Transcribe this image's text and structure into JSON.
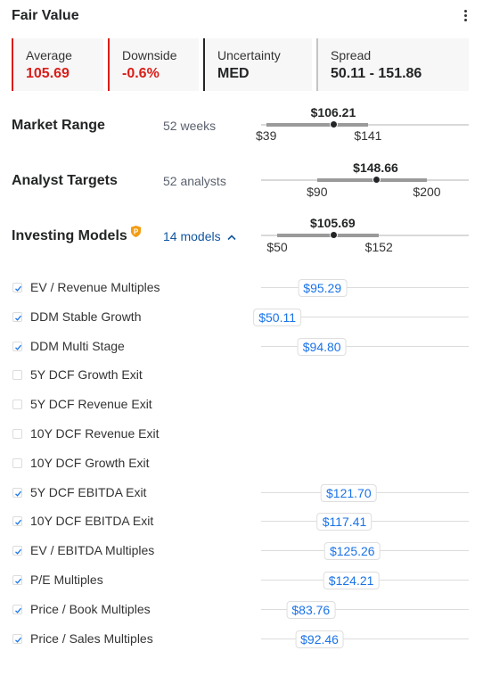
{
  "header": {
    "title": "Fair Value",
    "menu_icon": "more-vertical-icon"
  },
  "cards": [
    {
      "label": "Average",
      "value": "105.69",
      "accent": "#d91e18"
    },
    {
      "label": "Downside",
      "value": "-0.6%",
      "accent": "#d91e18"
    },
    {
      "label": "Uncertainty",
      "value": "MED",
      "accent": "#232526"
    },
    {
      "label": "Spread",
      "value": "50.11 - 151.86",
      "accent": "#c4c4c4"
    }
  ],
  "ranges": [
    {
      "name": "Market Range",
      "sub": "52 weeks",
      "current": "$106.21",
      "current_value": 106.21,
      "low_label": "$39",
      "low": 39,
      "high_label": "$141",
      "high": 141
    },
    {
      "name": "Analyst Targets",
      "sub": "52 analysts",
      "current": "$148.66",
      "current_value": 148.66,
      "low_label": "$90",
      "low": 90,
      "high_label": "$200",
      "high": 200
    },
    {
      "name": "Investing Models",
      "sub": "14 models",
      "sub_icon": "chevron-up-icon",
      "badge_icon": "pro-shield-icon",
      "current": "$105.69",
      "current_value": 105.69,
      "low_label": "$50",
      "low": 50,
      "high_label": "$152",
      "high": 152
    }
  ],
  "models": [
    {
      "label": "EV / Revenue Multiples",
      "checked": true,
      "value_label": "$95.29",
      "value": 95.29
    },
    {
      "label": "DDM Stable Growth",
      "checked": true,
      "value_label": "$50.11",
      "value": 50.11
    },
    {
      "label": "DDM Multi Stage",
      "checked": true,
      "value_label": "$94.80",
      "value": 94.8
    },
    {
      "label": "5Y DCF Growth Exit",
      "checked": false
    },
    {
      "label": "5Y DCF Revenue Exit",
      "checked": false
    },
    {
      "label": "10Y DCF Revenue Exit",
      "checked": false
    },
    {
      "label": "10Y DCF Growth Exit",
      "checked": false
    },
    {
      "label": "5Y DCF EBITDA Exit",
      "checked": true,
      "value_label": "$121.70",
      "value": 121.7
    },
    {
      "label": "10Y DCF EBITDA Exit",
      "checked": true,
      "value_label": "$117.41",
      "value": 117.41
    },
    {
      "label": "EV / EBITDA Multiples",
      "checked": true,
      "value_label": "$125.26",
      "value": 125.26
    },
    {
      "label": "P/E Multiples",
      "checked": true,
      "value_label": "$124.21",
      "value": 124.21
    },
    {
      "label": "Price / Book Multiples",
      "checked": true,
      "value_label": "$83.76",
      "value": 83.76
    },
    {
      "label": "Price / Sales Multiples",
      "checked": true,
      "value_label": "$92.46",
      "value": 92.46
    }
  ],
  "colors": {
    "negative": "#d91e18",
    "link": "#1256a0",
    "pill_text": "#1a73e8",
    "check": "#1a73e8",
    "pro_badge": "#f39c12"
  }
}
